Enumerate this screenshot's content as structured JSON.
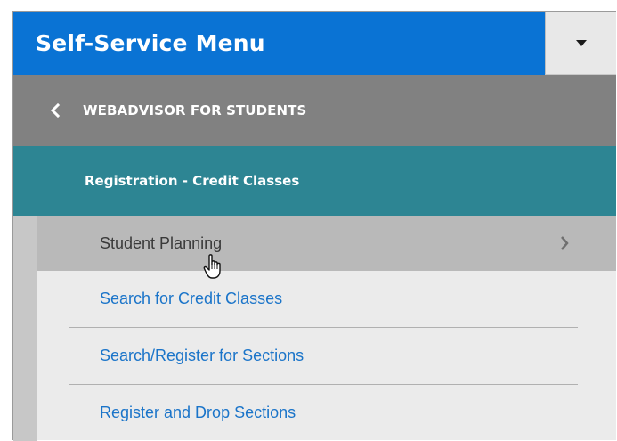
{
  "menu": {
    "title": "Self-Service Menu",
    "toggle_icon": "caret-down-icon"
  },
  "back": {
    "label": "WEBADVISOR FOR STUDENTS",
    "icon": "chevron-left-icon"
  },
  "section": {
    "label": "Registration - Credit Classes"
  },
  "items": [
    {
      "label": "Student Planning",
      "has_submenu": true,
      "highlighted": true
    },
    {
      "label": "Search for Credit Classes"
    },
    {
      "label": "Search/Register for Sections"
    },
    {
      "label": "Register and Drop Sections"
    }
  ],
  "colors": {
    "header_blue": "#0a73d4",
    "back_gray": "#818181",
    "section_teal": "#2d8593",
    "highlight_gray": "#b9b9b9",
    "link_blue": "#1a74c9"
  }
}
